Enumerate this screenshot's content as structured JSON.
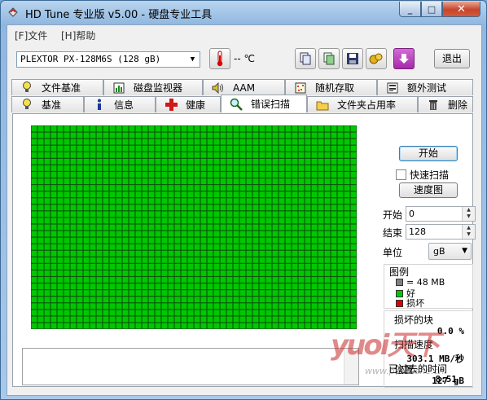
{
  "window": {
    "title": "HD Tune 专业版 v5.00 - 硬盘专业工具",
    "minimize_glyph": "_",
    "maximize_glyph": "□",
    "close_glyph": "✕"
  },
  "menu": {
    "items": [
      {
        "label": "[F]文件"
      },
      {
        "label": "[H]帮助"
      }
    ]
  },
  "toolbar": {
    "drive": "PLEXTOR PX-128M6S (128 gB)",
    "temperature": "-- ℃",
    "exit_label": "退出",
    "icons": [
      "copy-info-icon",
      "copy-screenshot-icon",
      "save-icon",
      "options-icon",
      "download-icon"
    ]
  },
  "tabs": {
    "row1": [
      {
        "label": "文件基准",
        "icon": "lightbulb-icon"
      },
      {
        "label": "磁盘监视器",
        "icon": "monitor-icon"
      },
      {
        "label": "AAM",
        "icon": "speaker-icon"
      },
      {
        "label": "随机存取",
        "icon": "random-access-icon"
      },
      {
        "label": "额外测试",
        "icon": "extra-tests-icon"
      }
    ],
    "row2": [
      {
        "label": "基准",
        "icon": "benchmark-icon"
      },
      {
        "label": "信息",
        "icon": "info-icon"
      },
      {
        "label": "健康",
        "icon": "health-icon"
      },
      {
        "label": "错误扫描",
        "icon": "magnifier-icon",
        "active": true
      },
      {
        "label": "文件夹占用率",
        "icon": "folder-icon"
      },
      {
        "label": "删除",
        "icon": "trash-icon"
      }
    ]
  },
  "scan": {
    "start_button": "开始",
    "quick_scan_label": "快速扫描",
    "quick_scan_checked": false,
    "speed_map_button": "速度图",
    "start_label": "开始",
    "start_value": "0",
    "end_label": "结束",
    "end_value": "128",
    "unit_label": "单位",
    "unit_value": "gB",
    "legend_title": "图例",
    "legend": [
      {
        "label": "= 48 MB",
        "color": "#808080"
      },
      {
        "label": "好",
        "color": "#00c800"
      },
      {
        "label": "损坏",
        "color": "#e00000"
      }
    ],
    "damaged_blocks_label": "损坏的块",
    "damaged_blocks_value": "0.0 %",
    "scan_speed_label": "扫描速度",
    "scan_speed_value": "303.1 MB/秒",
    "position_label": "位置",
    "position_value": "127 gB",
    "elapsed_label": "已过去的时间",
    "elapsed_value": "8:51",
    "block_color": "#00c800",
    "grid_line_color": "#0a5a0a"
  },
  "watermark": {
    "text": "yuoi天下",
    "url": "www.pcwaishe.cn"
  }
}
